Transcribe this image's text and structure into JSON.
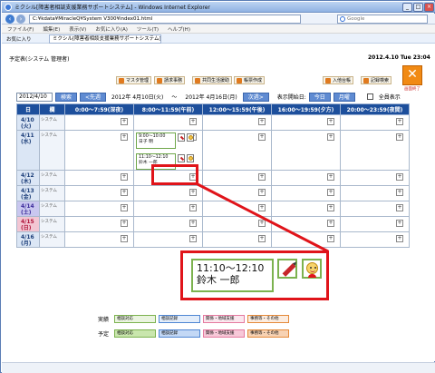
{
  "window": {
    "title": "ミクシル[障害者相談支援業務サポートシステム] - Windows Internet Explorer",
    "min": "_",
    "max": "□",
    "close": "×"
  },
  "browser": {
    "url": "C:¥kdata¥MiracleQ¥System V300¥index01.html",
    "search_placeholder": "Google",
    "favorites_label": "お気に入り",
    "tab_title": "ミクシル[障害者相談支援業務サポートシステム]",
    "menu": [
      "ファイル(F)",
      "編集(E)",
      "表示(V)",
      "お気に入り(A)",
      "ツール(T)",
      "ヘルプ(H)"
    ]
  },
  "page": {
    "title": "予定表(システム 管理者)",
    "datetime": "2012.4.10 Tue 23:04",
    "exit_label": "画面終了",
    "toolbar": [
      "マスタ管理",
      "請求事務",
      "共同生活援助",
      "帳票作成",
      "入他台帳",
      "記録検索"
    ]
  },
  "controls": {
    "date": "2012/4/10",
    "search": "検索",
    "prev": "<先週",
    "range_from": "2012年 4月10日(火)",
    "range_sep": "〜",
    "range_to": "2012年 4月16日(月)",
    "next": "次週>",
    "start_label": "表示開始日:",
    "today": "今日",
    "month": "月曜",
    "all_label": "全員表示"
  },
  "grid": {
    "headers": {
      "day": "日",
      "cat": "欄",
      "slots": [
        "0:00〜7:59(深夜)",
        "8:00〜11:59(午前)",
        "12:00〜15:59(午後)",
        "16:00〜19:59(夕方)",
        "20:00〜23:59(夜間)"
      ]
    },
    "plus": "+",
    "rows": [
      {
        "day": "4/10\n(火)",
        "cat": "システム"
      },
      {
        "day": "4/11\n(水)",
        "cat": "システム"
      },
      {
        "day": "4/12\n(木)",
        "cat": "システム"
      },
      {
        "day": "4/13\n(金)",
        "cat": "システム"
      },
      {
        "day": "4/14\n(土)",
        "cat": "システム"
      },
      {
        "day": "4/15\n(日)",
        "cat": "システム"
      },
      {
        "day": "4/16\n(月)",
        "cat": "システム"
      }
    ],
    "events": [
      {
        "time": "9:00〜10:00",
        "name": "日子 明"
      },
      {
        "time": "11:10〜12:10",
        "name": "鈴木 一郎"
      }
    ]
  },
  "callout": {
    "time": "11:10〜12:10",
    "name": "鈴木 一郎"
  },
  "legend": {
    "actual_label": "実績",
    "plan_label": "予定",
    "items": [
      "相談対応",
      "相談記録",
      "関係・地域支援",
      "事務等・その他"
    ],
    "colors": {
      "green": "#7cb24f",
      "blue": "#4f86d3",
      "pink": "#e57aa0",
      "orange": "#e58a3a"
    }
  }
}
